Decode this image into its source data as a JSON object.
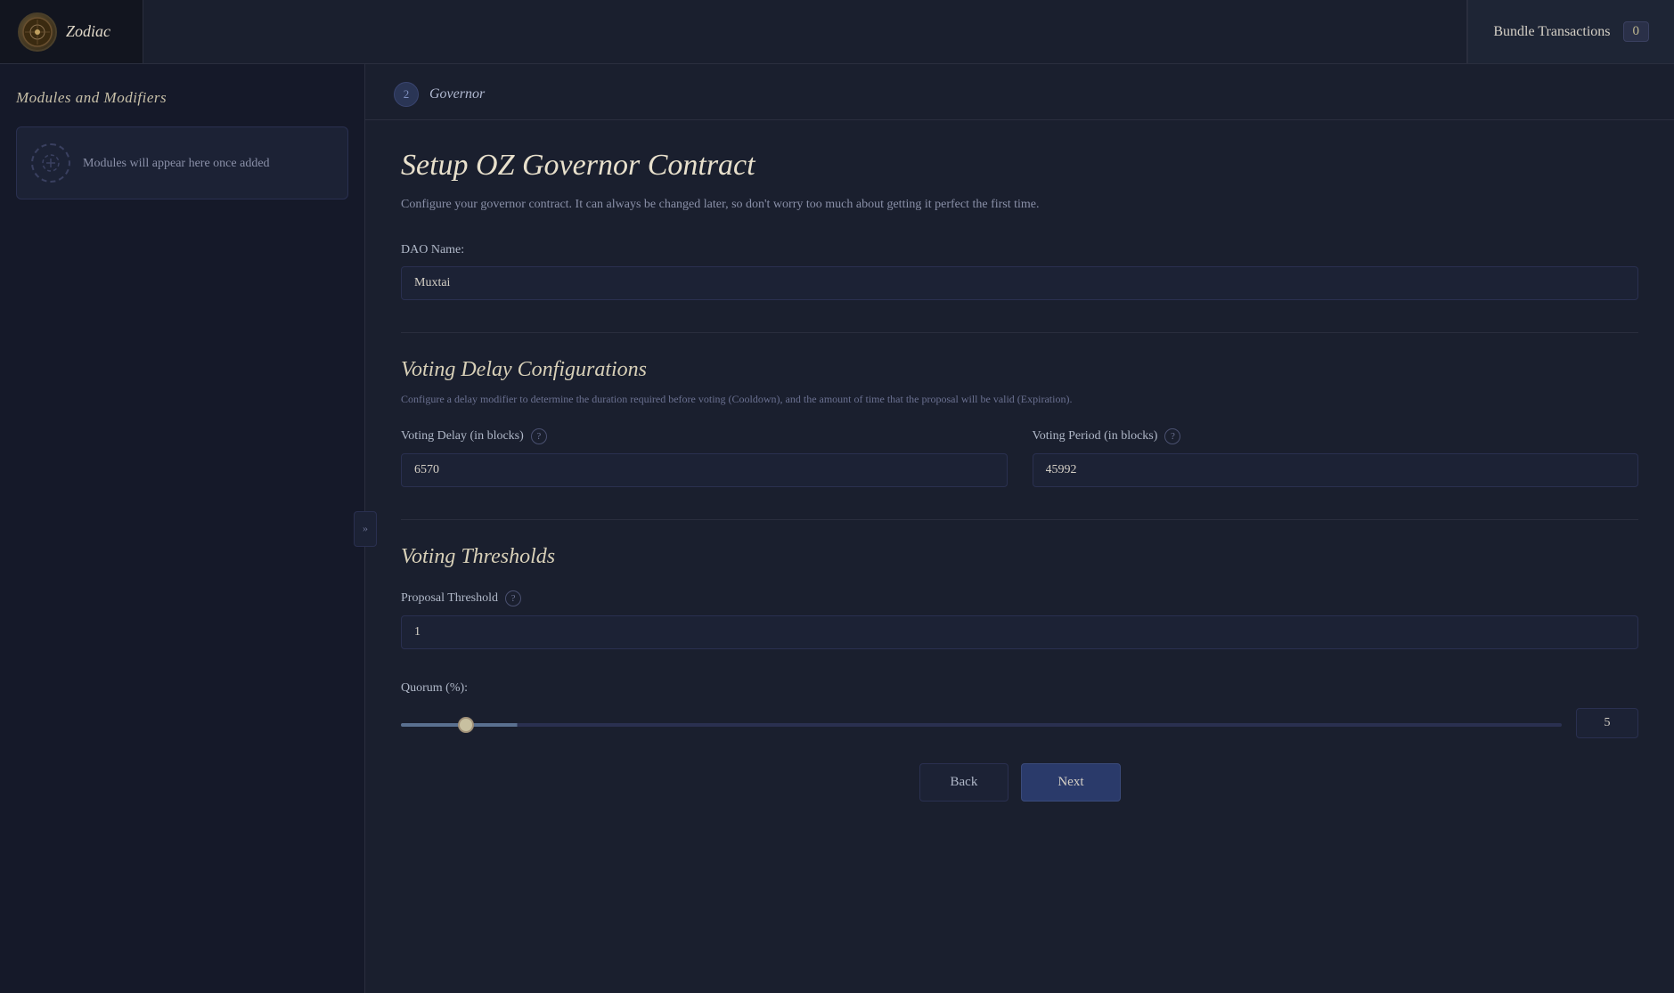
{
  "nav": {
    "logo_text": "Zodiac",
    "search_placeholder": "",
    "bundle_label": "Bundle Transactions",
    "bundle_count": "0"
  },
  "sidebar": {
    "title": "Modules and Modifiers",
    "empty_text": "Modules will appear here once added",
    "expand_icon": "»"
  },
  "step": {
    "number": "2",
    "label": "Governor"
  },
  "form": {
    "main_title": "Setup OZ Governor Contract",
    "description": "Configure your governor contract. It can always be changed later, so don't worry too much about getting it perfect the first time.",
    "dao_name_label": "DAO Name:",
    "dao_name_value": "Muxtai",
    "voting_delay_section_title": "Voting Delay Configurations",
    "voting_delay_section_desc": "Configure a delay modifier to determine the duration required before voting (Cooldown), and the amount of time that the proposal will be valid (Expiration).",
    "voting_delay_label": "Voting Delay (in blocks)",
    "voting_delay_value": "6570",
    "voting_period_label": "Voting Period (in blocks)",
    "voting_period_value": "45992",
    "thresholds_section_title": "Voting Thresholds",
    "proposal_threshold_label": "Proposal Threshold",
    "proposal_threshold_value": "1",
    "quorum_label": "Quorum (%):",
    "quorum_slider_value": 5,
    "quorum_input_value": "5"
  },
  "actions": {
    "back_label": "Back",
    "next_label": "Next"
  }
}
